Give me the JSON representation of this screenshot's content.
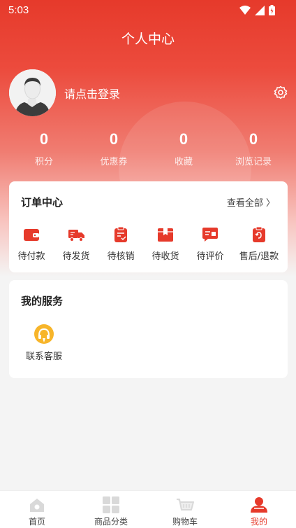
{
  "status_bar": {
    "time": "5:03"
  },
  "header": {
    "title": "个人中心"
  },
  "user": {
    "login_prompt": "请点击登录"
  },
  "stats": [
    {
      "value": "0",
      "label": "积分"
    },
    {
      "value": "0",
      "label": "优惠券"
    },
    {
      "value": "0",
      "label": "收藏"
    },
    {
      "value": "0",
      "label": "浏览记录"
    }
  ],
  "orders": {
    "title": "订单中心",
    "view_all": "查看全部 〉",
    "items": [
      {
        "label": "待付款",
        "icon": "wallet-icon"
      },
      {
        "label": "待发货",
        "icon": "truck-icon"
      },
      {
        "label": "待核销",
        "icon": "clipboard-check-icon"
      },
      {
        "label": "待收货",
        "icon": "package-icon"
      },
      {
        "label": "待评价",
        "icon": "review-icon"
      },
      {
        "label": "售后/退款",
        "icon": "refund-icon"
      }
    ]
  },
  "services": {
    "title": "我的服务",
    "items": [
      {
        "label": "联系客服",
        "icon": "headset-icon"
      }
    ]
  },
  "tabbar": {
    "items": [
      {
        "label": "首页",
        "icon": "home-icon"
      },
      {
        "label": "商品分类",
        "icon": "category-icon"
      },
      {
        "label": "购物车",
        "icon": "cart-icon"
      },
      {
        "label": "我的",
        "icon": "profile-icon",
        "active": true
      }
    ]
  },
  "colors": {
    "accent": "#e63a2b",
    "service_icon": "#f7b52a"
  }
}
